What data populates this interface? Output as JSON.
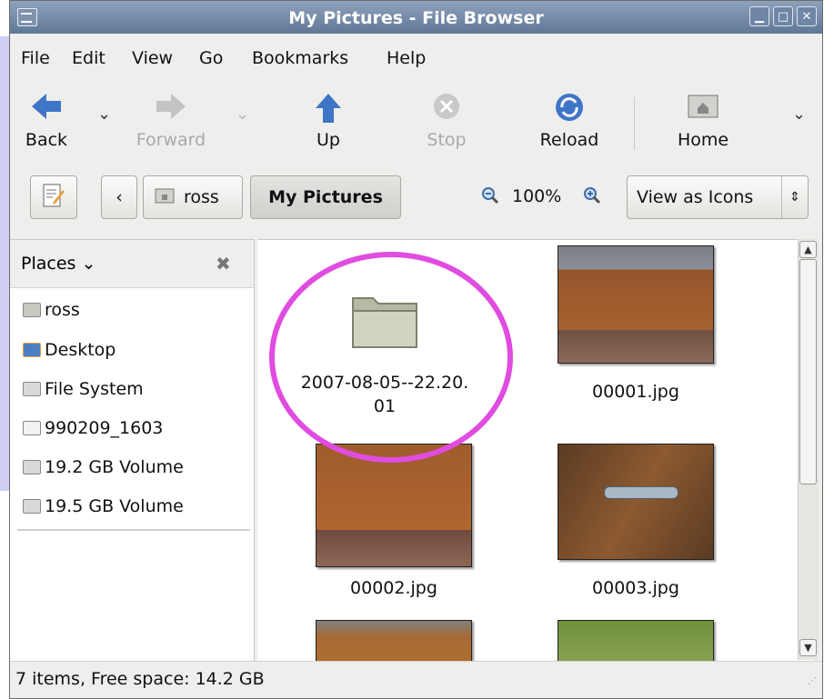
{
  "window": {
    "title": "My Pictures - File Browser"
  },
  "menu": {
    "items": [
      "File",
      "Edit",
      "View",
      "Go",
      "Bookmarks",
      "Help"
    ]
  },
  "toolbar": {
    "back": "Back",
    "forward": "Forward",
    "up": "Up",
    "stop": "Stop",
    "reload": "Reload",
    "home": "Home"
  },
  "location": {
    "crumb_home": "ross",
    "crumb_current": "My Pictures",
    "zoom": "100%",
    "view_as": "View as Icons"
  },
  "sidebar": {
    "header": "Places",
    "items": [
      {
        "label": "ross",
        "icon": "home-folder-icon"
      },
      {
        "label": "Desktop",
        "icon": "desktop-icon"
      },
      {
        "label": "File System",
        "icon": "drive-icon"
      },
      {
        "label": "990209_1603",
        "icon": "optical-drive-icon"
      },
      {
        "label": "19.2 GB Volume",
        "icon": "drive-icon"
      },
      {
        "label": "19.5 GB Volume",
        "icon": "drive-icon"
      }
    ]
  },
  "files": [
    {
      "name_line1": "2007-08-05--22.20.",
      "name_line2": "01",
      "type": "folder"
    },
    {
      "name": "00001.jpg",
      "type": "image"
    },
    {
      "name": "00002.jpg",
      "type": "image"
    },
    {
      "name": "00003.jpg",
      "type": "image"
    }
  ],
  "status": {
    "text": "7 items, Free space: 14.2 GB"
  },
  "colors": {
    "titlebar": "#6d84a5",
    "highlight_circle": "#e14ce0",
    "window_bg": "#eeeeec"
  }
}
